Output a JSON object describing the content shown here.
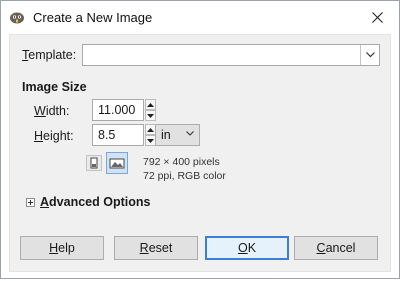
{
  "window": {
    "title": "Create a New Image",
    "icons": {
      "app": "gimp-icon",
      "close": "close-icon"
    }
  },
  "template": {
    "label_pre": "",
    "label_mn": "T",
    "label_post": "emplate:",
    "value": ""
  },
  "image_size": {
    "section_title": "Image Size",
    "width": {
      "label_mn": "W",
      "label_post": "idth:",
      "value": "11.000"
    },
    "height": {
      "label_mn": "H",
      "label_post": "eight:",
      "value": "8.5"
    },
    "unit": "in",
    "info_line1": "792 × 400 pixels",
    "info_line2": "72 ppi, RGB color"
  },
  "advanced": {
    "label_mn": "A",
    "label_post": "dvanced Options"
  },
  "buttons": {
    "help": {
      "mn": "H",
      "post": "elp"
    },
    "reset": {
      "mn": "R",
      "post": "eset"
    },
    "ok": {
      "mn": "O",
      "post": "K"
    },
    "cancel": {
      "mn": "C",
      "post": "ancel"
    }
  },
  "colors": {
    "accent": "#3c7fd4",
    "selected_orientation": "#cfe3f7"
  }
}
